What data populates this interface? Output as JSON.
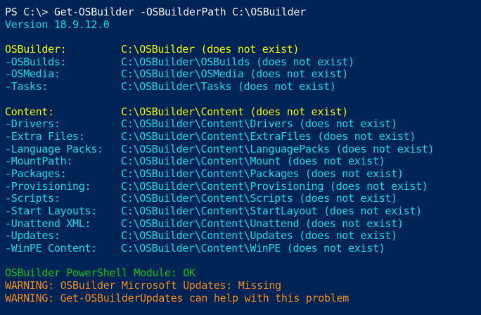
{
  "colors": {
    "background": "#012456",
    "prompt": "#eeedf0",
    "path": "#11d8e6",
    "heading": "#f2f200",
    "ok": "#13c113",
    "warning": "#f28a1c"
  },
  "prompt": {
    "text": "PS C:\\> ",
    "command": "Get-OSBuilder -OSBuilderPath C:\\OSBuilder"
  },
  "version_line": "Version 18.9.12.0",
  "osbuilder_group": {
    "heading": {
      "label": "OSBuilder:",
      "value": "C:\\OSBuilder (does not exist)"
    },
    "items": [
      {
        "label": "-OSBuilds:",
        "value": "C:\\OSBuilder\\OSBuilds (does not exist)"
      },
      {
        "label": "-OSMedia:",
        "value": "C:\\OSBuilder\\OSMedia (does not exist)"
      },
      {
        "label": "-Tasks:",
        "value": "C:\\OSBuilder\\Tasks (does not exist)"
      }
    ]
  },
  "content_group": {
    "heading": {
      "label": "Content:",
      "value": "C:\\OSBuilder\\Content (does not exist)"
    },
    "items": [
      {
        "label": "-Drivers:",
        "value": "C:\\OSBuilder\\Content\\Drivers (does not exist)"
      },
      {
        "label": "-Extra Files:",
        "value": "C:\\OSBuilder\\Content\\ExtraFiles (does not exist)"
      },
      {
        "label": "-Language Packs:",
        "value": "C:\\OSBuilder\\Content\\LanguagePacks (does not exist)"
      },
      {
        "label": "-MountPath:",
        "value": "C:\\OSBuilder\\Content\\Mount (does not exist)"
      },
      {
        "label": "-Packages:",
        "value": "C:\\OSBuilder\\Content\\Packages (does not exist)"
      },
      {
        "label": "-Provisioning:",
        "value": "C:\\OSBuilder\\Content\\Provisioning (does not exist)"
      },
      {
        "label": "-Scripts:",
        "value": "C:\\OSBuilder\\Content\\Scripts (does not exist)"
      },
      {
        "label": "-Start Layouts:",
        "value": "C:\\OSBuilder\\Content\\StartLayout (does not exist)"
      },
      {
        "label": "-Unattend XML:",
        "value": "C:\\OSBuilder\\Content\\Unattend (does not exist)"
      },
      {
        "label": "-Updates:",
        "value": "C:\\OSBuilder\\Content\\Updates (does not exist)"
      },
      {
        "label": "-WinPE Content:",
        "value": "C:\\OSBuilder\\Content\\WinPE (does not exist)"
      }
    ]
  },
  "status": {
    "module_ok": "OSBuilder PowerShell Module: OK",
    "warning_updates": "WARNING: OSBuilder Microsoft Updates: Missing",
    "warning_help": "WARNING: Get-OSBuilderUpdates can help with this problem"
  }
}
